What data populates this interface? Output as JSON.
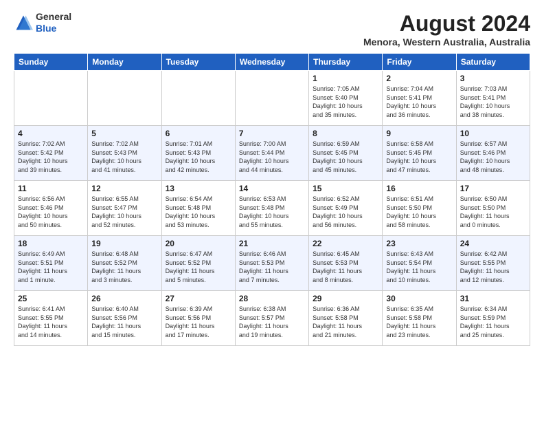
{
  "logo": {
    "line1": "General",
    "line2": "Blue"
  },
  "title": "August 2024",
  "subtitle": "Menora, Western Australia, Australia",
  "days_of_week": [
    "Sunday",
    "Monday",
    "Tuesday",
    "Wednesday",
    "Thursday",
    "Friday",
    "Saturday"
  ],
  "weeks": [
    [
      {
        "day": "",
        "info": ""
      },
      {
        "day": "",
        "info": ""
      },
      {
        "day": "",
        "info": ""
      },
      {
        "day": "",
        "info": ""
      },
      {
        "day": "1",
        "info": "Sunrise: 7:05 AM\nSunset: 5:40 PM\nDaylight: 10 hours\nand 35 minutes."
      },
      {
        "day": "2",
        "info": "Sunrise: 7:04 AM\nSunset: 5:41 PM\nDaylight: 10 hours\nand 36 minutes."
      },
      {
        "day": "3",
        "info": "Sunrise: 7:03 AM\nSunset: 5:41 PM\nDaylight: 10 hours\nand 38 minutes."
      }
    ],
    [
      {
        "day": "4",
        "info": "Sunrise: 7:02 AM\nSunset: 5:42 PM\nDaylight: 10 hours\nand 39 minutes."
      },
      {
        "day": "5",
        "info": "Sunrise: 7:02 AM\nSunset: 5:43 PM\nDaylight: 10 hours\nand 41 minutes."
      },
      {
        "day": "6",
        "info": "Sunrise: 7:01 AM\nSunset: 5:43 PM\nDaylight: 10 hours\nand 42 minutes."
      },
      {
        "day": "7",
        "info": "Sunrise: 7:00 AM\nSunset: 5:44 PM\nDaylight: 10 hours\nand 44 minutes."
      },
      {
        "day": "8",
        "info": "Sunrise: 6:59 AM\nSunset: 5:45 PM\nDaylight: 10 hours\nand 45 minutes."
      },
      {
        "day": "9",
        "info": "Sunrise: 6:58 AM\nSunset: 5:45 PM\nDaylight: 10 hours\nand 47 minutes."
      },
      {
        "day": "10",
        "info": "Sunrise: 6:57 AM\nSunset: 5:46 PM\nDaylight: 10 hours\nand 48 minutes."
      }
    ],
    [
      {
        "day": "11",
        "info": "Sunrise: 6:56 AM\nSunset: 5:46 PM\nDaylight: 10 hours\nand 50 minutes."
      },
      {
        "day": "12",
        "info": "Sunrise: 6:55 AM\nSunset: 5:47 PM\nDaylight: 10 hours\nand 52 minutes."
      },
      {
        "day": "13",
        "info": "Sunrise: 6:54 AM\nSunset: 5:48 PM\nDaylight: 10 hours\nand 53 minutes."
      },
      {
        "day": "14",
        "info": "Sunrise: 6:53 AM\nSunset: 5:48 PM\nDaylight: 10 hours\nand 55 minutes."
      },
      {
        "day": "15",
        "info": "Sunrise: 6:52 AM\nSunset: 5:49 PM\nDaylight: 10 hours\nand 56 minutes."
      },
      {
        "day": "16",
        "info": "Sunrise: 6:51 AM\nSunset: 5:50 PM\nDaylight: 10 hours\nand 58 minutes."
      },
      {
        "day": "17",
        "info": "Sunrise: 6:50 AM\nSunset: 5:50 PM\nDaylight: 11 hours\nand 0 minutes."
      }
    ],
    [
      {
        "day": "18",
        "info": "Sunrise: 6:49 AM\nSunset: 5:51 PM\nDaylight: 11 hours\nand 1 minute."
      },
      {
        "day": "19",
        "info": "Sunrise: 6:48 AM\nSunset: 5:52 PM\nDaylight: 11 hours\nand 3 minutes."
      },
      {
        "day": "20",
        "info": "Sunrise: 6:47 AM\nSunset: 5:52 PM\nDaylight: 11 hours\nand 5 minutes."
      },
      {
        "day": "21",
        "info": "Sunrise: 6:46 AM\nSunset: 5:53 PM\nDaylight: 11 hours\nand 7 minutes."
      },
      {
        "day": "22",
        "info": "Sunrise: 6:45 AM\nSunset: 5:53 PM\nDaylight: 11 hours\nand 8 minutes."
      },
      {
        "day": "23",
        "info": "Sunrise: 6:43 AM\nSunset: 5:54 PM\nDaylight: 11 hours\nand 10 minutes."
      },
      {
        "day": "24",
        "info": "Sunrise: 6:42 AM\nSunset: 5:55 PM\nDaylight: 11 hours\nand 12 minutes."
      }
    ],
    [
      {
        "day": "25",
        "info": "Sunrise: 6:41 AM\nSunset: 5:55 PM\nDaylight: 11 hours\nand 14 minutes."
      },
      {
        "day": "26",
        "info": "Sunrise: 6:40 AM\nSunset: 5:56 PM\nDaylight: 11 hours\nand 15 minutes."
      },
      {
        "day": "27",
        "info": "Sunrise: 6:39 AM\nSunset: 5:56 PM\nDaylight: 11 hours\nand 17 minutes."
      },
      {
        "day": "28",
        "info": "Sunrise: 6:38 AM\nSunset: 5:57 PM\nDaylight: 11 hours\nand 19 minutes."
      },
      {
        "day": "29",
        "info": "Sunrise: 6:36 AM\nSunset: 5:58 PM\nDaylight: 11 hours\nand 21 minutes."
      },
      {
        "day": "30",
        "info": "Sunrise: 6:35 AM\nSunset: 5:58 PM\nDaylight: 11 hours\nand 23 minutes."
      },
      {
        "day": "31",
        "info": "Sunrise: 6:34 AM\nSunset: 5:59 PM\nDaylight: 11 hours\nand 25 minutes."
      }
    ]
  ]
}
